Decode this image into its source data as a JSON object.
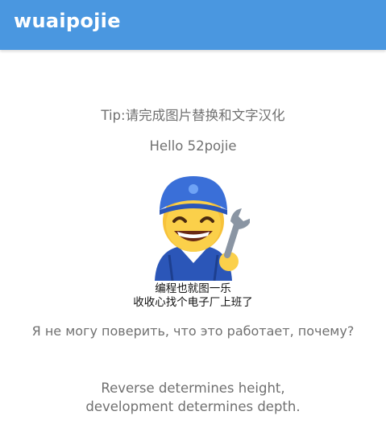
{
  "app_bar": {
    "title": "wuaipojie",
    "color": "#4a97e0"
  },
  "main": {
    "tip": "Tip:请完成图片替换和文字汉化",
    "hello": "Hello 52pojie",
    "image": {
      "icon": "mechanic-emoji-icon",
      "caption_line1": "编程也就图一乐",
      "caption_line2": "收收心找个电子厂上班了"
    },
    "russian_text": "Я не могу поверить, что это работает, почему?",
    "footer_line1": "Reverse determines height,",
    "footer_line2": "development determines depth."
  }
}
